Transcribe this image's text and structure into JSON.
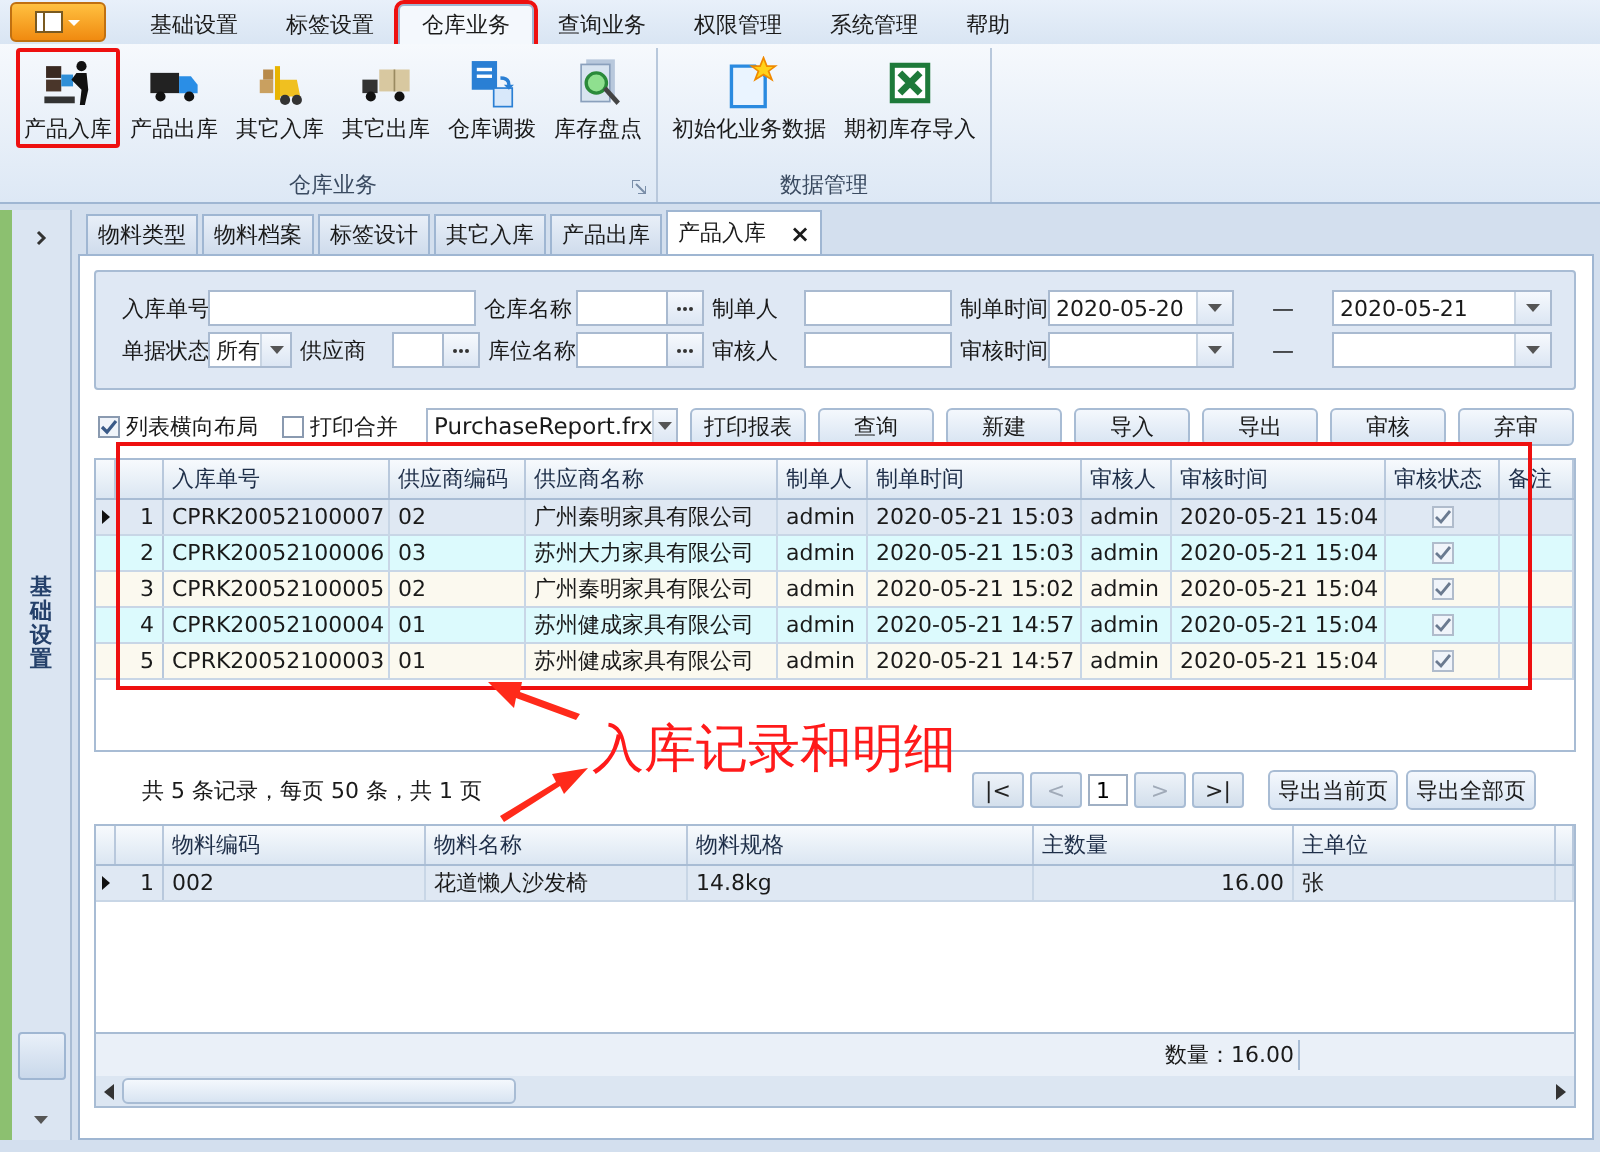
{
  "menu": {
    "tabs": [
      {
        "label": "基础设置",
        "selected": false,
        "highlighted": false
      },
      {
        "label": "标签设置",
        "selected": false,
        "highlighted": false
      },
      {
        "label": "仓库业务",
        "selected": true,
        "highlighted": true
      },
      {
        "label": "查询业务",
        "selected": false,
        "highlighted": false
      },
      {
        "label": "权限管理",
        "selected": false,
        "highlighted": false
      },
      {
        "label": "系统管理",
        "selected": false,
        "highlighted": false
      },
      {
        "label": "帮助",
        "selected": false,
        "highlighted": false
      }
    ]
  },
  "ribbon": {
    "groups": [
      {
        "title": "仓库业务",
        "launcher": true,
        "buttons": [
          {
            "label": "产品入库",
            "highlighted": true
          },
          {
            "label": "产品出库",
            "highlighted": false
          },
          {
            "label": "其它入库",
            "highlighted": false
          },
          {
            "label": "其它出库",
            "highlighted": false
          },
          {
            "label": "仓库调拨",
            "highlighted": false
          },
          {
            "label": "库存盘点",
            "highlighted": false
          }
        ]
      },
      {
        "title": "数据管理",
        "launcher": false,
        "buttons": [
          {
            "label": "初始化业务数据",
            "highlighted": false
          },
          {
            "label": "期初库存导入",
            "highlighted": false
          }
        ]
      }
    ]
  },
  "sidebar": {
    "title": "基础设置"
  },
  "doc_tabs": [
    {
      "label": "物料类型",
      "selected": false
    },
    {
      "label": "物料档案",
      "selected": false
    },
    {
      "label": "标签设计",
      "selected": false
    },
    {
      "label": "其它入库",
      "selected": false
    },
    {
      "label": "产品出库",
      "selected": false
    },
    {
      "label": "产品入库",
      "selected": true,
      "close": "×"
    }
  ],
  "filter": {
    "rows": [
      {
        "fields": [
          {
            "label": "入库单号",
            "kind": "text"
          },
          {
            "label": "仓库名称",
            "kind": "lookup"
          },
          {
            "label": "制单人",
            "kind": "text"
          },
          {
            "label": "制单时间",
            "kind": "date_range",
            "from": "2020-05-20",
            "separator": "—",
            "to": "2020-05-21"
          }
        ]
      },
      {
        "fields": [
          {
            "label": "单据状态",
            "kind": "combo",
            "value": "所有"
          },
          {
            "label": "供应商",
            "kind": "lookup"
          },
          {
            "label": "库位名称",
            "kind": "lookup"
          },
          {
            "label": "审核人",
            "kind": "text"
          },
          {
            "label": "审核时间",
            "kind": "date_range",
            "separator": "—"
          }
        ]
      }
    ]
  },
  "toolbar": {
    "options": [
      {
        "label": "列表横向布局",
        "checked": true
      },
      {
        "label": "打印合并",
        "checked": false
      }
    ],
    "report": "PurchaseReport.frx",
    "buttons": [
      "打印报表",
      "查询",
      "新建",
      "导入",
      "导出",
      "审核",
      "弃审"
    ]
  },
  "master": {
    "columns": [
      "入库单号",
      "供应商编码",
      "供应商名称",
      "制单人",
      "制单时间",
      "审核人",
      "审核时间",
      "审核状态",
      "备注"
    ],
    "rows": [
      {
        "num": "1",
        "selected": true,
        "audited": true,
        "cells": [
          "CPRK20052100007",
          "02",
          "广州秦明家具有限公司",
          "admin",
          "2020-05-21 15:03",
          "admin",
          "2020-05-21 15:04"
        ]
      },
      {
        "num": "2",
        "selected": false,
        "audited": true,
        "cells": [
          "CPRK20052100006",
          "03",
          "苏州大力家具有限公司",
          "admin",
          "2020-05-21 15:03",
          "admin",
          "2020-05-21 15:04"
        ]
      },
      {
        "num": "3",
        "selected": false,
        "audited": true,
        "cells": [
          "CPRK20052100005",
          "02",
          "广州秦明家具有限公司",
          "admin",
          "2020-05-21 15:02",
          "admin",
          "2020-05-21 15:04"
        ]
      },
      {
        "num": "4",
        "selected": false,
        "audited": true,
        "cells": [
          "CPRK20052100004",
          "01",
          "苏州健成家具有限公司",
          "admin",
          "2020-05-21 14:57",
          "admin",
          "2020-05-21 15:04"
        ]
      },
      {
        "num": "5",
        "selected": false,
        "audited": true,
        "cells": [
          "CPRK20052100003",
          "01",
          "苏州健成家具有限公司",
          "admin",
          "2020-05-21 14:57",
          "admin",
          "2020-05-21 15:04"
        ]
      }
    ]
  },
  "callout": "入库记录和明细",
  "pager": {
    "summary": "共 5 条记录，每页 50 条，共 1 页",
    "prev": [
      {
        "label": "|<",
        "disabled": false
      },
      {
        "label": "<",
        "disabled": true
      }
    ],
    "page": "1",
    "next": [
      {
        "label": ">",
        "disabled": true
      },
      {
        "label": ">|",
        "disabled": false
      }
    ],
    "exports": [
      "导出当前页",
      "导出全部页"
    ]
  },
  "detail": {
    "columns": [
      {
        "label": "物料编码",
        "kind": "text"
      },
      {
        "label": "物料名称",
        "kind": "text"
      },
      {
        "label": "物料规格",
        "kind": "text"
      },
      {
        "label": "主数量",
        "kind": "number"
      },
      {
        "label": "主单位",
        "kind": "text"
      }
    ],
    "rows": [
      {
        "num": "1",
        "selected": true,
        "cells": [
          "002",
          "花道懒人沙发椅",
          "14.8kg",
          "16.00",
          "张"
        ]
      }
    ],
    "footer": "数量：16.00"
  }
}
